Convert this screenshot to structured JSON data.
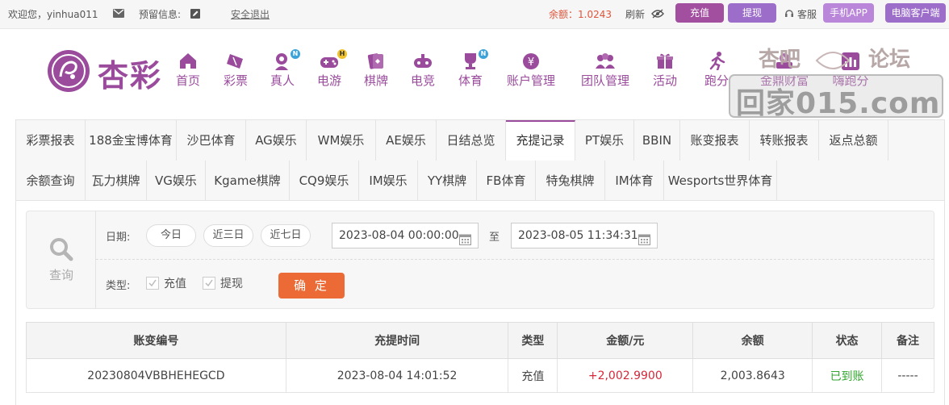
{
  "topbar": {
    "welcome": "欢迎您，yinhua011",
    "reserved": "预留信息:",
    "logout": "安全退出",
    "balance": "余额：1.0243",
    "refresh": "刷新",
    "charge": "充值",
    "withdraw": "提现",
    "service": "客服",
    "mobile_app": "手机APP",
    "pc_client": "电脑客户端"
  },
  "logo": {
    "text": "杏彩"
  },
  "nav": [
    {
      "label": "首页",
      "icon": "home-icon"
    },
    {
      "label": "彩票",
      "icon": "ticket-icon"
    },
    {
      "label": "真人",
      "icon": "dealer-icon",
      "badge": "N"
    },
    {
      "label": "电游",
      "icon": "gamepad-icon",
      "badge": "H"
    },
    {
      "label": "棋牌",
      "icon": "cards-icon"
    },
    {
      "label": "电竞",
      "icon": "controller-icon"
    },
    {
      "label": "体育",
      "icon": "trophy-icon",
      "badge": "N"
    },
    {
      "label": "账户管理",
      "icon": "account-icon"
    },
    {
      "label": "团队管理",
      "icon": "team-icon"
    },
    {
      "label": "活动",
      "icon": "gift-icon"
    },
    {
      "label": "跑分",
      "icon": "running-icon"
    },
    {
      "label": "金鼎财富",
      "icon": "wealth-icon"
    },
    {
      "label": "嗨跑分",
      "icon": "chart-icon"
    }
  ],
  "watermark": {
    "line1": "杏吧",
    "line2": "论坛",
    "line3": "回家015.com"
  },
  "tabs_row1": [
    "彩票报表",
    "188金宝博体育",
    "沙巴体育",
    "AG娱乐",
    "WM娱乐",
    "AE娱乐",
    "日结总览",
    "充提记录",
    "PT娱乐",
    "BBIN",
    "账变报表",
    "转账报表",
    "返点总额"
  ],
  "tabs_row2": [
    "余额查询",
    "瓦力棋牌",
    "VG娱乐",
    "Kgame棋牌",
    "CQ9娱乐",
    "IM娱乐",
    "YY棋牌",
    "FB体育",
    "特兔棋牌",
    "IM体育",
    "Wesports世界体育"
  ],
  "active_tab": "充提记录",
  "query": {
    "title": "查询",
    "date_label": "日期:",
    "today": "今日",
    "three_days": "近三日",
    "seven_days": "近七日",
    "start": "2023-08-04 00:00:00",
    "to": "至",
    "end": "2023-08-05 11:34:31",
    "type_label": "类型:",
    "type_charge": "充值",
    "type_withdraw": "提现",
    "confirm": "确 定"
  },
  "table": {
    "headers": [
      "账变编号",
      "充提时间",
      "类型",
      "金额/元",
      "余额",
      "状态",
      "备注"
    ],
    "rows": [
      [
        "20230804VBBHEHEGCD",
        "2023-08-04 14:01:52",
        "充值",
        "+2,002.9900",
        "2,003.8643",
        "已到账",
        "-----"
      ]
    ]
  },
  "colors": {
    "brand": "#9a4b9c",
    "accent": "#ec6a35",
    "amount": "#d5283a",
    "status_ok": "#31a52e"
  }
}
